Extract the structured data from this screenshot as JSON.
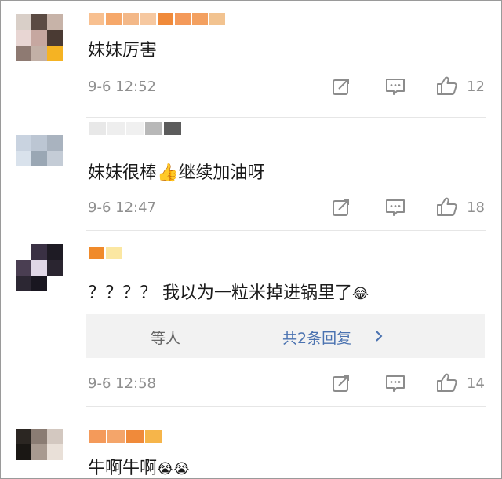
{
  "comments": [
    {
      "text": "妹妹厉害",
      "time": "9-6 12:52",
      "likes": "12",
      "avatar_colors": [
        "#d9cfc8",
        "#5b4b43",
        "#c7b3a8",
        "#e8d6d3",
        "#c6a7a0",
        "#4a3a33",
        "#8e7a72",
        "#c2b0a6",
        "#f5b323"
      ],
      "name_colors": [
        "#f8c090",
        "#f6a86a",
        "#f3b888",
        "#f6c8a0",
        "#f08a3a",
        "#f49a5a",
        "#f3a060",
        "#f2c390"
      ]
    },
    {
      "text": "妹妹很棒👍继续加油呀",
      "time": "9-6 12:47",
      "likes": "18",
      "avatar_colors": [
        "#c9d3e0",
        "#bcc6d3",
        "#a9b3bf",
        "#d9e2ec",
        "#9aa7b4",
        "#c4ccd6"
      ],
      "name_colors": [
        "#e8e8e8",
        "#eeeeee",
        "#f0f0f0",
        "#b8b8b8",
        "#5c5c5c"
      ]
    },
    {
      "text": "？？？？ 我以为一粒米掉进锅里了",
      "emoji": "😂",
      "time": "9-6 12:58",
      "likes": "14",
      "replies_label": "等人",
      "replies_link": "共2条回复",
      "avatar_colors": [
        "#ffffff",
        "#3a3144",
        "#1e1b24",
        "#4a3e52",
        "#e0d7e6",
        "#2a2530",
        "#2c2733",
        "#191620",
        "#ffffff"
      ],
      "name_colors": [
        "#f08a2a",
        "#fbe7a2"
      ]
    },
    {
      "text": "牛啊牛啊",
      "emoji": "😭😭",
      "avatar_colors": [
        "#2b2622",
        "#8a7c73",
        "#d3c8c0",
        "#1a1714",
        "#a89a90",
        "#e9e0d8"
      ],
      "name_colors": [
        "#f49a5a",
        "#f4a56a",
        "#f08a3a",
        "#f6b54a"
      ]
    }
  ]
}
